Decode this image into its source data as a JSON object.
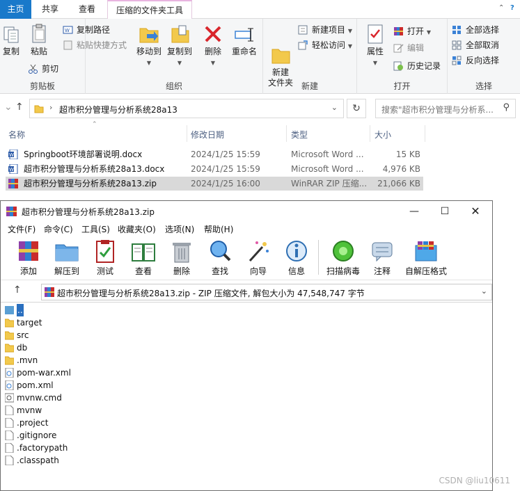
{
  "ribbon": {
    "tabs": [
      "主页",
      "共享",
      "查看",
      "压缩的文件夹工具"
    ],
    "clipboard": {
      "label": "剪贴板",
      "copy": "复制",
      "paste": "粘贴",
      "copy_path": "复制路径",
      "paste_shortcut": "粘贴快捷方式",
      "cut": "剪切"
    },
    "organize": {
      "label": "组织",
      "move_to": "移动到",
      "copy_to": "复制到",
      "delete": "删除",
      "rename": "重命名"
    },
    "new": {
      "label": "新建",
      "new_folder": "新建\n文件夹",
      "new_item": "新建项目",
      "easy_access": "轻松访问"
    },
    "open": {
      "label": "打开",
      "properties": "属性",
      "open": "打开",
      "edit": "编辑",
      "history": "历史记录"
    },
    "select": {
      "label": "选择",
      "select_all": "全部选择",
      "select_none": "全部取消",
      "invert": "反向选择"
    }
  },
  "address": {
    "path": "超市积分管理与分析系统28a13",
    "search_placeholder": "搜索\"超市积分管理与分析系..."
  },
  "file_list": {
    "columns": [
      "名称",
      "修改日期",
      "类型",
      "大小"
    ],
    "rows": [
      {
        "name": "Springboot环境部署说明.docx",
        "date": "2024/1/25 15:59",
        "type": "Microsoft Word ...",
        "size": "15 KB"
      },
      {
        "name": "超市积分管理与分析系统28a13.docx",
        "date": "2024/1/25 15:59",
        "type": "Microsoft Word ...",
        "size": "4,976 KB"
      },
      {
        "name": "超市积分管理与分析系统28a13.zip",
        "date": "2024/1/25 16:00",
        "type": "WinRAR ZIP 压缩...",
        "size": "21,066 KB"
      }
    ]
  },
  "winrar": {
    "title": "超市积分管理与分析系统28a13.zip",
    "menu": [
      "文件(F)",
      "命令(C)",
      "工具(S)",
      "收藏夹(O)",
      "选项(N)",
      "帮助(H)"
    ],
    "tools": [
      "添加",
      "解压到",
      "测试",
      "查看",
      "删除",
      "查找",
      "向导",
      "信息",
      "扫描病毒",
      "注释",
      "自解压格式"
    ],
    "path_text": "超市积分管理与分析系统28a13.zip - ZIP 压缩文件, 解包大小为 47,548,747 字节",
    "items": [
      "..",
      "target",
      "src",
      "db",
      ".mvn",
      "pom-war.xml",
      "pom.xml",
      "mvnw.cmd",
      "mvnw",
      ".project",
      ".gitignore",
      ".factorypath",
      ".classpath"
    ]
  },
  "watermark": "CSDN @liu10611"
}
